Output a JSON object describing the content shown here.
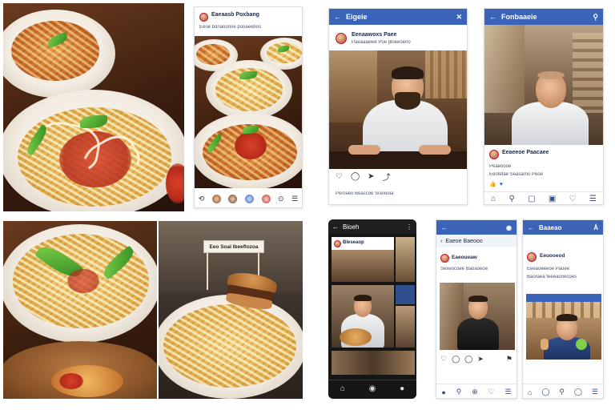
{
  "feed_post": {
    "username": "Eaeaasb Poxbang",
    "caption": "Eeoe bonaoonoe pooaeebos"
  },
  "mobile_post": {
    "app_title": "Eigeie",
    "username": "Eenaawoxs Paee",
    "caption": "Paeaaaewe Poe ploeeoeno",
    "footer_caption": "Perceeo Beaccoe Scexeoa"
  },
  "portrait_post": {
    "app_title": "Fonbaaeie",
    "username": "Eeaeeoe Paacaee",
    "caption_line1": "Peaeoooe",
    "caption_line2": "Eeotetae Seasarno Peoe"
  },
  "sign_text": "Eeo Soal Ibeeflozoa",
  "dark_phone": {
    "app_title": "Bioeh",
    "username": "Bleseaop"
  },
  "phone_b": {
    "app_title": "Eaeoe Baeooo",
    "username": "Eaeoueaw",
    "caption": "Sexeocoee Baoaoeoe"
  },
  "phone_c": {
    "app_title": "Baaeao",
    "username": "Eeuooeod",
    "caption_line1": "Eeeaoeeeoe Pauee",
    "caption_line2": "Baoraea feeeaonecoes"
  },
  "icons": {
    "like": "heart-icon",
    "comment": "comment-icon",
    "share": "send-icon",
    "save": "bookmark-icon",
    "home": "home-icon",
    "search": "search-icon",
    "back": "back-arrow-icon",
    "close": "close-icon"
  },
  "colors": {
    "brand_blue": "#3b64b8",
    "nav_blue": "#2f4f8f",
    "sauce_red": "#c0321c",
    "pasta_gold": "#e0ac4c"
  }
}
